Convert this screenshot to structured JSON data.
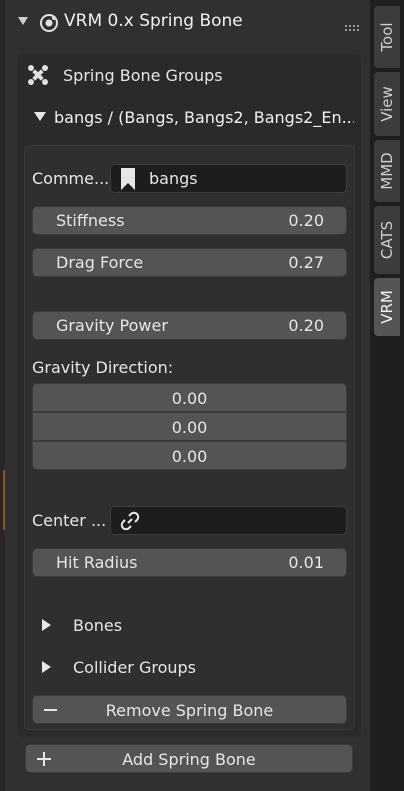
{
  "panel": {
    "title": "VRM 0.x Spring Bone",
    "groups_label": "Spring Bone Groups",
    "group": {
      "title": "bangs / (Bangs, Bangs2, Bangs2_En...",
      "comment_label": "Comme...",
      "comment_value": "bangs",
      "stiffness": {
        "label": "Stiffness",
        "value": "0.20"
      },
      "drag_force": {
        "label": "Drag Force",
        "value": "0.27"
      },
      "gravity_power": {
        "label": "Gravity Power",
        "value": "0.20"
      },
      "gravity_direction_label": "Gravity Direction:",
      "gravity_direction": [
        "0.00",
        "0.00",
        "0.00"
      ],
      "center_label": "Center ...",
      "hit_radius": {
        "label": "Hit Radius",
        "value": "0.01"
      },
      "bones_label": "Bones",
      "collider_groups_label": "Collider Groups",
      "remove_button": "Remove Spring Bone"
    },
    "add_button": "Add Spring Bone"
  },
  "tabs": [
    "Tool",
    "View",
    "MMD",
    "CATS",
    "VRM"
  ],
  "active_tab": "VRM",
  "colors": {
    "accent_line": "#b36a1f",
    "button": "#545454",
    "field": "#1d1d1d"
  },
  "icons": {
    "header": "vrm-circle-icon",
    "groups": "bone-group-icon",
    "comment": "bookmark-icon",
    "center": "link-icon",
    "remove": "minus-icon",
    "add": "plus-icon"
  }
}
